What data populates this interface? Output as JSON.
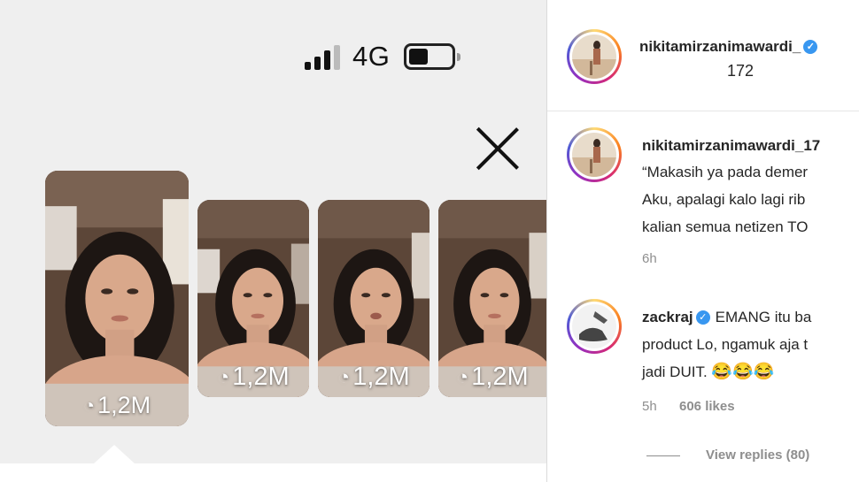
{
  "phone": {
    "network": "4G",
    "battery_level": 0.45,
    "stories": [
      {
        "views": "1,2M",
        "selected": true
      },
      {
        "views": "1,2M",
        "selected": false
      },
      {
        "views": "1,2M",
        "selected": false
      },
      {
        "views": "1,2M",
        "selected": false
      }
    ]
  },
  "header": {
    "username": "nikitamirzanimawardi_",
    "username_line2": "172"
  },
  "comments": [
    {
      "username": "nikitamirzanimawardi_17",
      "lines": [
        "“Makasih ya pada demer",
        "Aku, apalagi kalo lagi rib",
        "kalian semua netizen TO"
      ],
      "time": "6h"
    },
    {
      "username": "zackraj",
      "text_first": "EMANG itu ba",
      "lines": [
        "product Lo, ngamuk aja t",
        "jadi DUIT."
      ],
      "emojis": "😂😂😂",
      "time": "5h",
      "likes": "606 likes",
      "view_replies": "View replies (80)"
    }
  ],
  "colors": {
    "verified": "#3897f0",
    "meta": "#8e8e8e",
    "text": "#262626"
  }
}
